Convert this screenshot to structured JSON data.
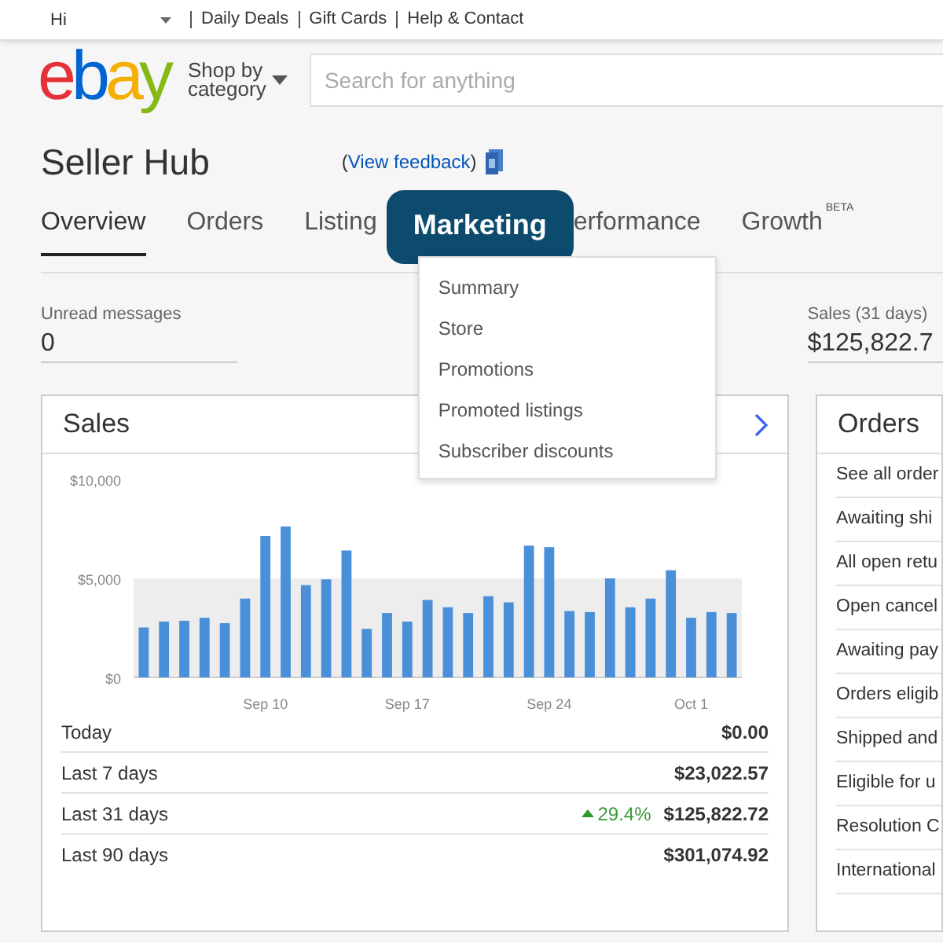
{
  "top_bar": {
    "greeting": "Hi",
    "links": [
      "Daily Deals",
      "Gift Cards",
      "Help & Contact"
    ]
  },
  "header": {
    "logo": "ebay",
    "shop_by": "Shop by category",
    "search": {
      "placeholder": "Search for anything"
    }
  },
  "page_title": "Seller Hub",
  "feedback_link": {
    "open": "(",
    "text": "View feedback",
    "close": ")"
  },
  "tabs": [
    {
      "label": "Overview",
      "selected": true,
      "highlighted": false
    },
    {
      "label": "Orders",
      "selected": false,
      "highlighted": false
    },
    {
      "label": "Listing",
      "selected": false,
      "highlighted": false
    },
    {
      "label": "Marketing",
      "selected": false,
      "highlighted": true
    },
    {
      "label": "erformance",
      "selected": false,
      "highlighted": false
    },
    {
      "label": "Growth",
      "badge": "BETA",
      "selected": false,
      "highlighted": false
    }
  ],
  "marketing_menu": [
    "Summary",
    "Store",
    "Promotions",
    "Promoted listings",
    "Subscriber discounts"
  ],
  "stats": [
    {
      "label": "Unread messages",
      "value": "0"
    },
    {
      "label": "Sales (31 days)",
      "value": "$125,822.7"
    }
  ],
  "sales_card": {
    "title": "Sales",
    "chart_data": {
      "type": "bar",
      "categories": [
        null,
        null,
        null,
        null,
        null,
        null,
        "Sep 10",
        null,
        null,
        null,
        null,
        null,
        null,
        "Sep 17",
        null,
        null,
        null,
        null,
        null,
        null,
        "Sep 24",
        null,
        null,
        null,
        null,
        null,
        null,
        "Oct 1",
        null,
        null
      ],
      "series": [
        {
          "color": "#4a90d9",
          "values": [
            2520,
            2820,
            2860,
            3010,
            2740,
            3980,
            7140,
            7620,
            4660,
            4950,
            6410,
            2450,
            3250,
            2820,
            3910,
            3540,
            3250,
            4100,
            3790,
            6650,
            6580,
            3350,
            3300,
            5000,
            3540,
            3980,
            5410,
            3010,
            3300,
            3250
          ]
        }
      ],
      "ylim": [
        0,
        10000
      ],
      "yticks": [
        {
          "value": 0,
          "label": "$0"
        },
        {
          "value": 5000,
          "label": "$5,000"
        },
        {
          "value": 10000,
          "label": "$10,000"
        }
      ]
    },
    "rows": [
      {
        "label": "Today",
        "value": "$0.00"
      },
      {
        "label": "Last 7 days",
        "value": "$23,022.57"
      },
      {
        "label": "Last 31 days",
        "value": "$125,822.72",
        "change": {
          "text": "29.4%",
          "rising": true
        }
      },
      {
        "label": "Last 90 days",
        "value": "$301,074.92"
      }
    ]
  },
  "orders_card": {
    "title": "Orders",
    "items": [
      "See all order",
      "Awaiting shi",
      "All open retu",
      "Open cancel",
      "Awaiting pay",
      "Orders eligib",
      "Shipped and",
      "Eligible for u",
      "Resolution C",
      "International"
    ]
  }
}
